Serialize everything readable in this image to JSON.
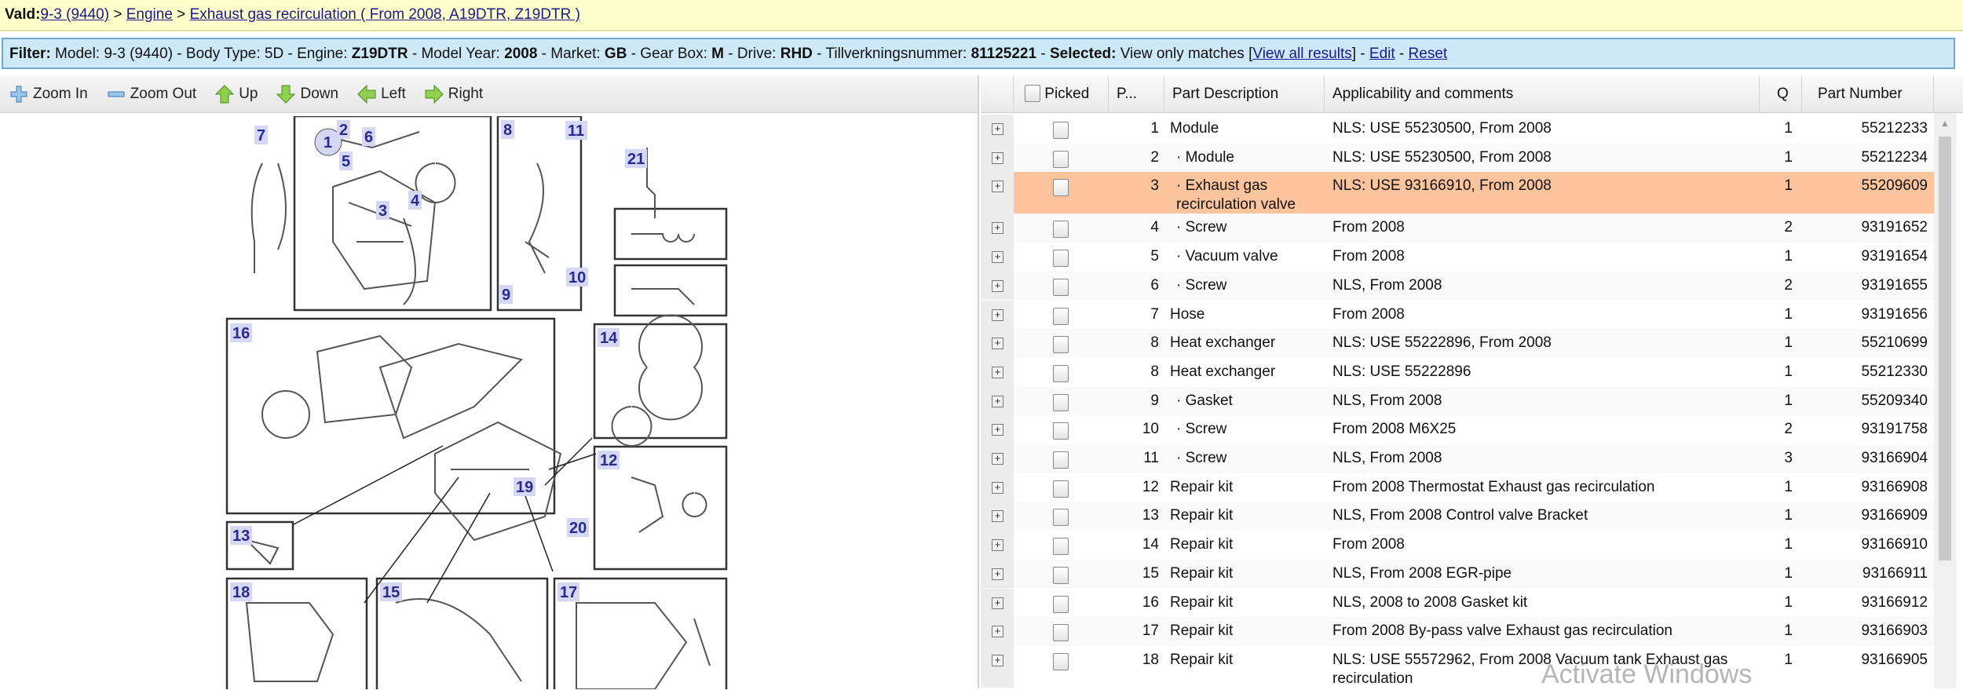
{
  "breadcrumb": {
    "prefix": "Vald:",
    "items": [
      "9-3 (9440)",
      "Engine",
      "Exhaust gas recirculation ( From 2008, A19DTR, Z19DTR )"
    ],
    "sep": " > "
  },
  "filter": {
    "parts": [
      {
        "k": "Filter:",
        "v": " Model: 9-3 (9440) - Body Type: 5D - Engine: "
      },
      {
        "k": "Z19DTR",
        "v": " - Model Year: "
      },
      {
        "k": "2008",
        "v": " - Market: "
      },
      {
        "k": "GB",
        "v": " - Gear Box: "
      },
      {
        "k": "M",
        "v": " - Drive: "
      },
      {
        "k": "RHD",
        "v": " - Tillverkningsnummer: "
      },
      {
        "k": "81125221",
        "v": " - "
      },
      {
        "k": "Selected:",
        "v": " View only matches ["
      }
    ],
    "view_all": "View all results",
    "close_bracket": "] - ",
    "edit": "Edit",
    "dash": " - ",
    "reset": "Reset"
  },
  "toolbar": {
    "zoom_in": "Zoom In",
    "zoom_out": "Zoom Out",
    "up": "Up",
    "down": "Down",
    "left": "Left",
    "right": "Right"
  },
  "diagram": {
    "labels": [
      "1",
      "2",
      "3",
      "4",
      "5",
      "6",
      "7",
      "8",
      "9",
      "10",
      "11",
      "12",
      "13",
      "14",
      "15",
      "16",
      "17",
      "18",
      "19",
      "20",
      "21"
    ]
  },
  "table": {
    "headers": {
      "picked": "Picked",
      "pos": "P...",
      "desc": "Part Description",
      "app": "Applicability and comments",
      "q": "Q",
      "part": "Part Number"
    },
    "rows": [
      {
        "pos": "1",
        "desc": "Module",
        "app": "NLS: USE 55230500, From 2008",
        "q": "1",
        "part": "55212233"
      },
      {
        "pos": "2",
        "desc": "· Module",
        "app": "NLS: USE 55230500, From 2008",
        "q": "1",
        "part": "55212234"
      },
      {
        "pos": "3",
        "desc": "· Exhaust gas recirculation valve",
        "app": "NLS: USE 93166910, From 2008",
        "q": "1",
        "part": "55209609",
        "selected": true
      },
      {
        "pos": "4",
        "desc": "· Screw",
        "app": "From 2008",
        "q": "2",
        "part": "93191652"
      },
      {
        "pos": "5",
        "desc": "· Vacuum valve",
        "app": "From 2008",
        "q": "1",
        "part": "93191654"
      },
      {
        "pos": "6",
        "desc": "· Screw",
        "app": "NLS, From 2008",
        "q": "2",
        "part": "93191655"
      },
      {
        "pos": "7",
        "desc": "Hose",
        "app": "From 2008",
        "q": "1",
        "part": "93191656"
      },
      {
        "pos": "8",
        "desc": "Heat exchanger",
        "app": "NLS: USE 55222896, From 2008",
        "q": "1",
        "part": "55210699"
      },
      {
        "pos": "8",
        "desc": "Heat exchanger",
        "app": "NLS: USE 55222896",
        "q": "1",
        "part": "55212330"
      },
      {
        "pos": "9",
        "desc": "· Gasket",
        "app": "NLS, From 2008",
        "q": "1",
        "part": "55209340"
      },
      {
        "pos": "10",
        "desc": "· Screw",
        "app": "From 2008 M6X25",
        "q": "2",
        "part": "93191758"
      },
      {
        "pos": "11",
        "desc": "· Screw",
        "app": "NLS, From 2008",
        "q": "3",
        "part": "93166904"
      },
      {
        "pos": "12",
        "desc": "Repair kit",
        "app": "From 2008 Thermostat Exhaust gas recirculation",
        "q": "1",
        "part": "93166908"
      },
      {
        "pos": "13",
        "desc": "Repair kit",
        "app": "NLS, From 2008 Control valve Bracket",
        "q": "1",
        "part": "93166909"
      },
      {
        "pos": "14",
        "desc": "Repair kit",
        "app": "From 2008",
        "q": "1",
        "part": "93166910"
      },
      {
        "pos": "15",
        "desc": "Repair kit",
        "app": "NLS, From 2008 EGR-pipe",
        "q": "1",
        "part": "93166911"
      },
      {
        "pos": "16",
        "desc": "Repair kit",
        "app": "NLS, 2008 to 2008 Gasket kit",
        "q": "1",
        "part": "93166912"
      },
      {
        "pos": "17",
        "desc": "Repair kit",
        "app": "From 2008 By-pass valve Exhaust gas recirculation",
        "q": "1",
        "part": "93166903"
      },
      {
        "pos": "18",
        "desc": "Repair kit",
        "app": "NLS: USE 55572962, From 2008 Vacuum tank Exhaust gas recirculation",
        "q": "1",
        "part": "93166905"
      }
    ]
  },
  "watermark": "Activate Windows",
  "colors": {
    "selected_row": "#fcc49c",
    "crumb_bg": "#ffffcc",
    "filter_bg": "#cde9f8",
    "label_bg": "#d6d6f5",
    "label_fg": "#2a2a8a"
  }
}
